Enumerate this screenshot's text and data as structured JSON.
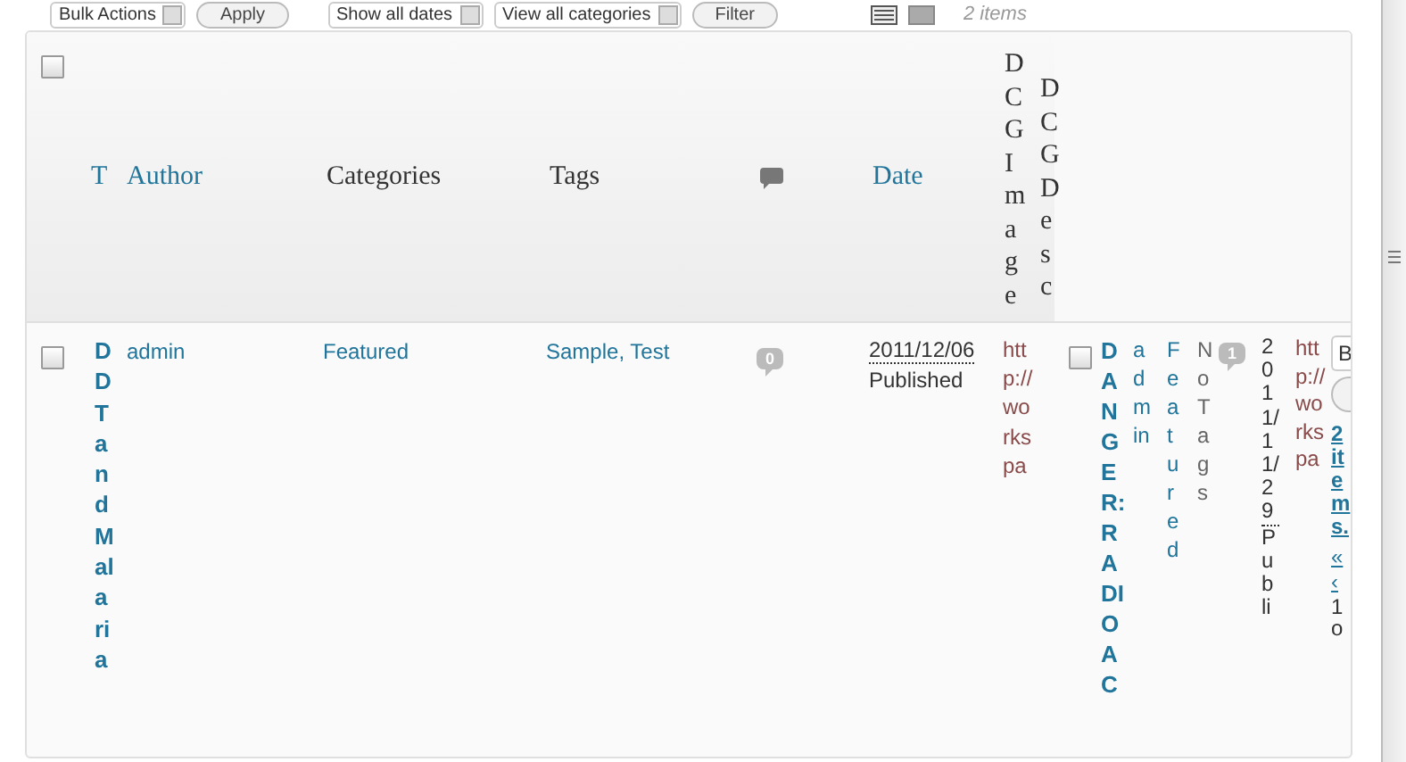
{
  "toolbar": {
    "bulk_action": "Bulk Actions",
    "apply": "Apply",
    "date_filter": "Show all dates",
    "category_filter": "View all categories",
    "filter": "Filter",
    "view_modes": [
      {
        "kind": "list",
        "selected": true
      },
      {
        "kind": "excerpt",
        "selected": false
      }
    ],
    "item_count": "2 items"
  },
  "table": {
    "select_all": {
      "checked": false
    },
    "columns": [
      {
        "label": "T",
        "kind": "link"
      },
      {
        "label": "Author",
        "kind": "link"
      },
      {
        "label": "Categories",
        "kind": "plain"
      },
      {
        "label": "Tags",
        "kind": "plain"
      },
      {
        "kind": "comments"
      },
      {
        "label": "Date",
        "kind": "link"
      },
      {
        "label": "DCG Image",
        "kind": "vertical"
      },
      {
        "label": "DCG Desc",
        "kind": "vertical"
      }
    ],
    "rows": [
      {
        "kind": "wide",
        "checked": false,
        "title": "DDT and Malaria",
        "author": "admin",
        "categories": "Featured",
        "tags": "Sample, Test",
        "comments": "0",
        "date": "2011/12/06",
        "status": "Published",
        "image_url": "http://workspa"
      },
      {
        "kind": "squeezed",
        "checked": false,
        "title": "DANGER: RADIOAC",
        "author": "admin",
        "categories": "Featured",
        "tags": "No Tags",
        "comments": "1",
        "date": "2011/11/29",
        "status": "Publi",
        "image_url": "http://workspa"
      }
    ],
    "pagination": {
      "bulk_action": "B",
      "count": "2 items.",
      "first": "«",
      "prev": "‹",
      "page": "1 o"
    }
  }
}
